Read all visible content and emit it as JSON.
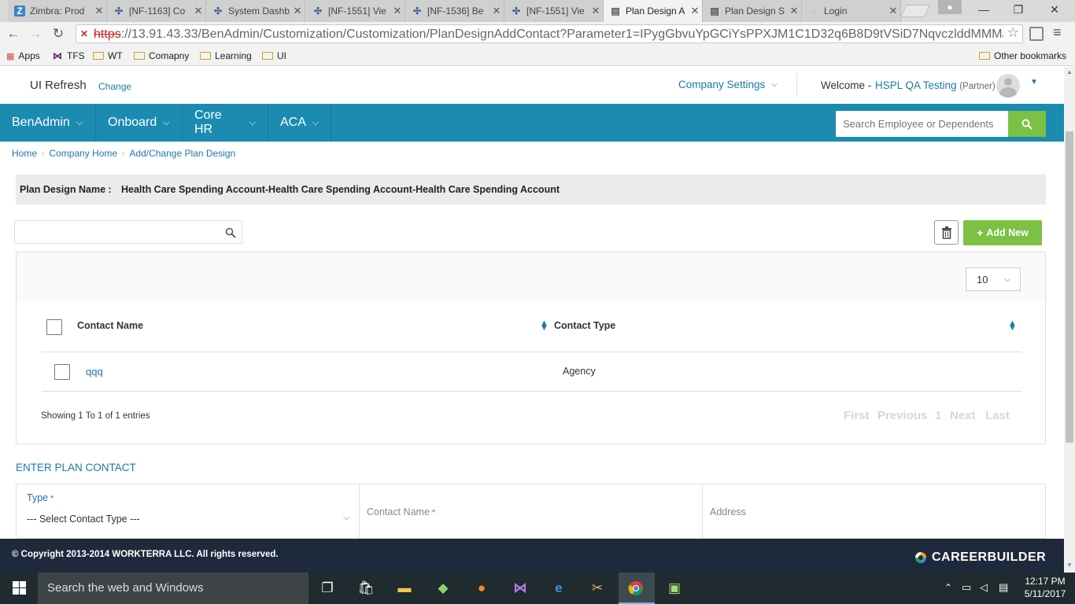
{
  "browser": {
    "tabs": [
      {
        "title": "Zimbra: Prod",
        "icon": "zimbra-icon",
        "active": false
      },
      {
        "title": "[NF-1163] Co",
        "icon": "jira-icon",
        "active": false
      },
      {
        "title": "System Dashb",
        "icon": "jira-icon",
        "active": false
      },
      {
        "title": "[NF-1551] Vie",
        "icon": "jira-icon",
        "active": false
      },
      {
        "title": "[NF-1536] Be",
        "icon": "jira-icon",
        "active": false
      },
      {
        "title": "[NF-1551] Vie",
        "icon": "jira-icon",
        "active": false
      },
      {
        "title": "Plan Design A",
        "icon": "page-icon",
        "active": true
      },
      {
        "title": "Plan Design S",
        "icon": "page-icon",
        "active": false
      },
      {
        "title": "Login",
        "icon": "loading-icon",
        "active": false
      }
    ],
    "url_protocol": "https",
    "url_rest": "://13.91.43.33/BenAdmin/Customization/Customization/PlanDesignAddContact?Parameter1=IPygGbvuYpGCiYsPPXJM1C1D32q6B8D9tVSiD7NqvczlddMMManS",
    "bookmarks": [
      "Apps",
      "TFS",
      "WT",
      "Comapny",
      "Learning",
      "UI"
    ],
    "other_bookmarks": "Other bookmarks"
  },
  "header": {
    "title": "UI Refresh",
    "change_link": "Change",
    "company_settings": "Company Settings",
    "welcome": "Welcome -",
    "user": "HSPL QA Testing",
    "role": "(Partner)"
  },
  "nav": {
    "items": [
      "BenAdmin",
      "Onboard",
      "Core HR",
      "ACA"
    ],
    "search_placeholder": "Search Employee or Dependents"
  },
  "breadcrumb": [
    "Home",
    "Company Home",
    "Add/Change Plan Design"
  ],
  "plan": {
    "label": "Plan Design Name :",
    "name": "Health Care Spending Account-Health Care Spending Account-Health Care Spending Account"
  },
  "toolbar": {
    "add_new": "Add New"
  },
  "grid": {
    "page_size": "10",
    "columns": [
      "Contact Name",
      "Contact Type"
    ],
    "rows": [
      {
        "name": "qqq",
        "type": "Agency"
      }
    ],
    "showing": "Showing 1 To 1 of 1 entries",
    "pager": [
      "First",
      "Previous",
      "1",
      "Next",
      "Last"
    ]
  },
  "form": {
    "heading": "ENTER PLAN CONTACT",
    "type_label": "Type",
    "type_value": "--- Select Contact Type ---",
    "contact_label": "Contact Name",
    "address_label": "Address"
  },
  "footer": {
    "copyright": "© Copyright 2013-2014 WORKTERRA LLC. All rights reserved.",
    "brand": "CAREERBUILDER"
  },
  "taskbar": {
    "search": "Search the web and Windows",
    "time": "12:17 PM",
    "date": "5/11/2017"
  },
  "colors": {
    "nav_bg": "#1b8bb1",
    "accent_green": "#7bc143",
    "link_blue": "#1b7aa8",
    "footer_bg": "#1e2a3b"
  }
}
